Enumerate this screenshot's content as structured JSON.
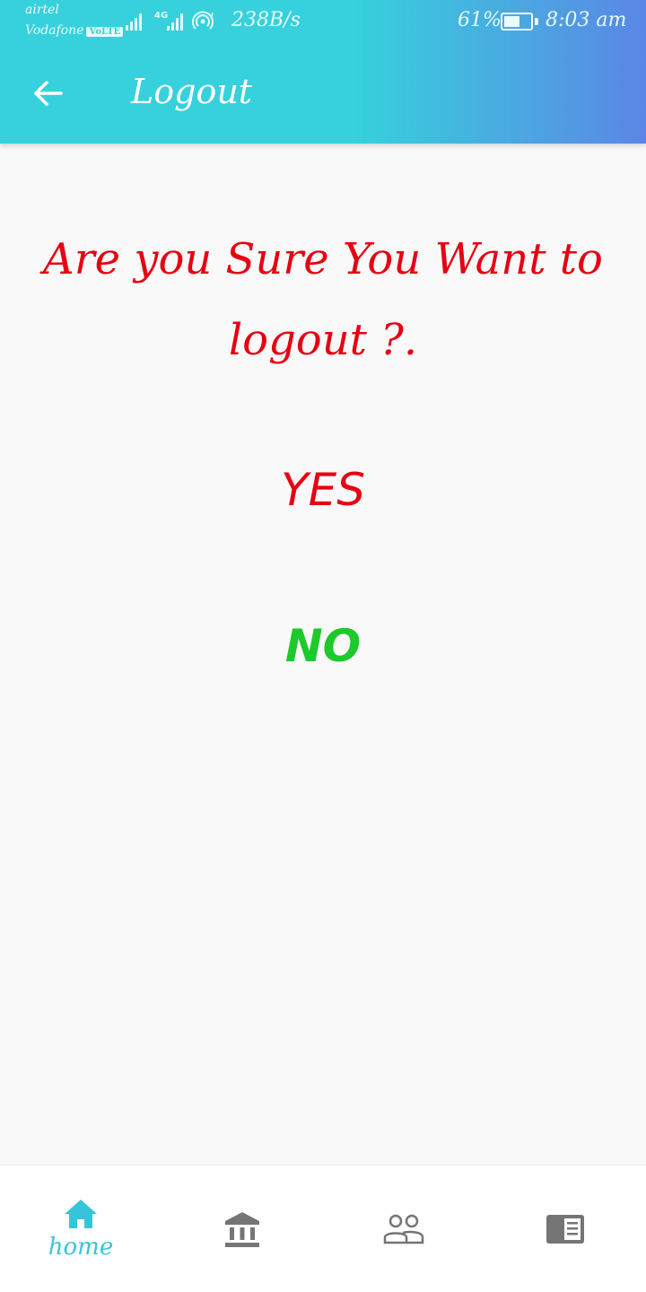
{
  "status_bar": {
    "carrier_1": "airtel",
    "carrier_2": "Vodafone",
    "volte_badge": "VoLTE",
    "network_type": "4G",
    "speed": "238B/s",
    "battery_percent": "61%",
    "battery_level": 0.61,
    "time": "8:03 am"
  },
  "header": {
    "back_icon": "arrow-left-icon",
    "title": "Logout"
  },
  "dialog": {
    "question": "Are you Sure You Want to logout ?.",
    "yes_label": "YES",
    "no_label": "NO"
  },
  "bottom_nav": {
    "items": [
      {
        "icon": "home-icon",
        "label": "home",
        "active": true
      },
      {
        "icon": "bank-icon",
        "label": "",
        "active": false
      },
      {
        "icon": "people-icon",
        "label": "",
        "active": false
      },
      {
        "icon": "article-icon",
        "label": "",
        "active": false
      }
    ]
  },
  "colors": {
    "header_gradient_start": "#36d1dc",
    "header_gradient_end": "#5b86e5",
    "question": "#e60012",
    "yes": "#e60012",
    "no": "#1ec92b",
    "nav_active": "#36c5d8",
    "nav_inactive": "#757575"
  }
}
